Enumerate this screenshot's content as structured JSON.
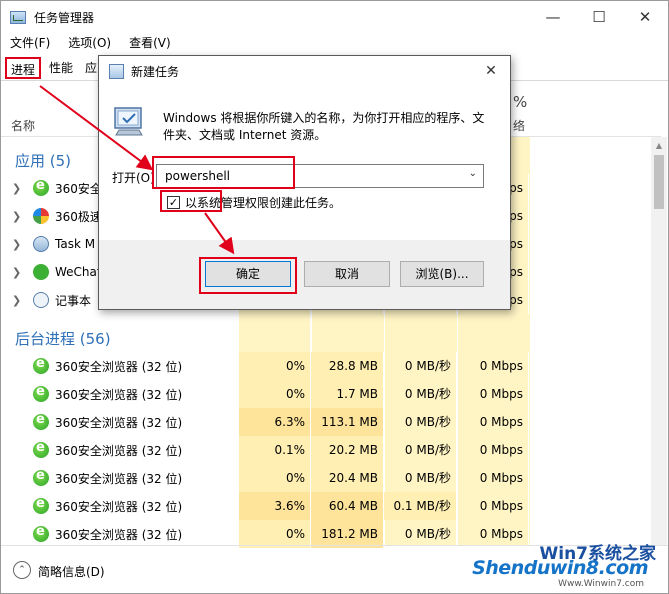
{
  "window": {
    "title": "任务管理器",
    "controls": {
      "minimize": "—",
      "maximize": "☐",
      "close": "✕"
    }
  },
  "menu": [
    "文件(F)",
    "选项(O)",
    "查看(V)"
  ],
  "tabs": [
    "进程",
    "性能",
    "应"
  ],
  "columns": {
    "name": "名称",
    "percent": "%",
    "sub": "络"
  },
  "sections": {
    "apps": "应用 (5)",
    "background": "后台进程 (56)"
  },
  "apps": [
    {
      "name": "360安全",
      "icon": "360-browser-icon",
      "net": "Mbps"
    },
    {
      "name": "360极速",
      "icon": "360-speed-browser-icon",
      "net": "Mbps"
    },
    {
      "name": "Task M",
      "icon": "task-manager-icon",
      "net": "Mbps"
    },
    {
      "name": "WeChat",
      "icon": "wechat-icon",
      "net": "Mbps"
    },
    {
      "name": "记事本",
      "icon": "notepad-icon",
      "net": "Mbps"
    }
  ],
  "processes": [
    {
      "name": "360安全浏览器 (32 位)",
      "cpu": "0%",
      "mem": "28.8 MB",
      "disk": "0 MB/秒",
      "net": "0 Mbps"
    },
    {
      "name": "360安全浏览器 (32 位)",
      "cpu": "0%",
      "mem": "1.7 MB",
      "disk": "0 MB/秒",
      "net": "0 Mbps"
    },
    {
      "name": "360安全浏览器 (32 位)",
      "cpu": "6.3%",
      "mem": "113.1 MB",
      "disk": "0 MB/秒",
      "net": "0 Mbps"
    },
    {
      "name": "360安全浏览器 (32 位)",
      "cpu": "0.1%",
      "mem": "20.2 MB",
      "disk": "0 MB/秒",
      "net": "0 Mbps"
    },
    {
      "name": "360安全浏览器 (32 位)",
      "cpu": "0%",
      "mem": "20.4 MB",
      "disk": "0 MB/秒",
      "net": "0 Mbps"
    },
    {
      "name": "360安全浏览器 (32 位)",
      "cpu": "3.6%",
      "mem": "60.4 MB",
      "disk": "0.1 MB/秒",
      "net": "0 Mbps"
    },
    {
      "name": "360安全浏览器 (32 位)",
      "cpu": "0%",
      "mem": "181.2 MB",
      "disk": "0 MB/秒",
      "net": "0 Mbps"
    }
  ],
  "footer": {
    "label": "简略信息(D)"
  },
  "watermark": {
    "top": "Win7系统之家",
    "main": "Shenduwin8.com",
    "sub": "Www.Winwin7.com"
  },
  "dialog": {
    "title": "新建任务",
    "description": "Windows 将根据你所键入的名称，为你打开相应的程序、文件夹、文档或 Internet 资源。",
    "open_label": "打开(O):",
    "open_value": "powershell",
    "checkbox_label": "以系统管理权限创建此任务。",
    "checkbox_checked": "✓",
    "ok": "确定",
    "cancel": "取消",
    "browse": "浏览(B)...",
    "close": "✕"
  },
  "annotation_color": "#e0001a"
}
